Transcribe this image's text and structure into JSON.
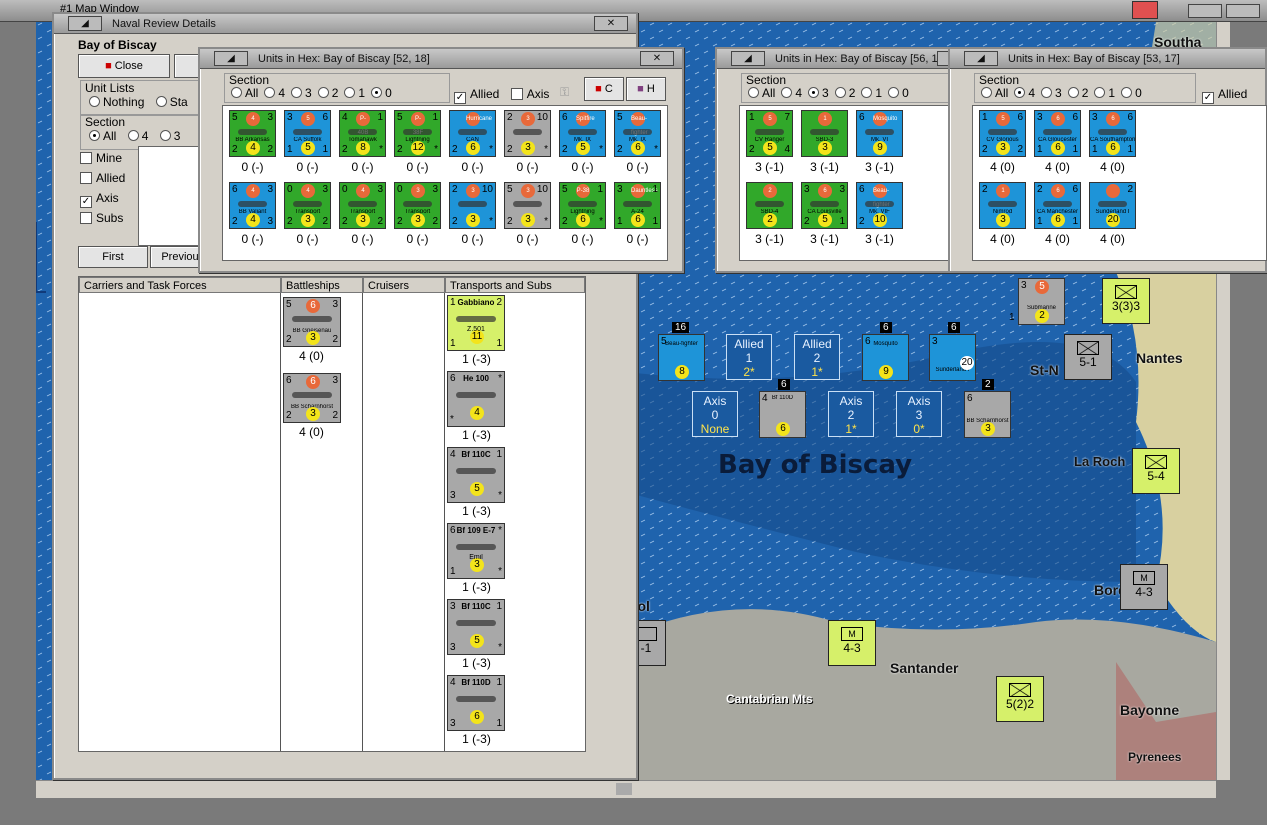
{
  "map_window": {
    "title": "#1 Map Window"
  },
  "naval_review": {
    "title": "Naval Review Details",
    "location": "Bay of Biscay",
    "close_label": "Close",
    "unit_lists_label": "Unit Lists",
    "unit_list_options": [
      "Nothing",
      "Sta"
    ],
    "section_label": "Section",
    "section_options": [
      "All",
      "4",
      "3"
    ],
    "filters": [
      {
        "label": "Mine",
        "checked": false
      },
      {
        "label": "Allied",
        "checked": false
      },
      {
        "label": "Axis",
        "checked": true
      },
      {
        "label": "Subs",
        "checked": false
      }
    ],
    "first_label": "First",
    "previous_label": "Previou",
    "columns": [
      "Carriers and Task Forces",
      "Battleships",
      "Cruisers",
      "Transports and Subs"
    ],
    "battleships": [
      {
        "name": "BB Gneisenau",
        "tl": "5",
        "tc": "6",
        "tr": "3",
        "bl": "2",
        "bc": "3",
        "br": "2",
        "str": "4 (0)"
      },
      {
        "name": "BB Scharnhorst",
        "tl": "6",
        "tc": "6",
        "tr": "3",
        "bl": "2",
        "bc": "3",
        "br": "2",
        "str": "4 (0)"
      }
    ],
    "transports": [
      {
        "name": "Z.501",
        "top": "Gabbiano",
        "tl": "1",
        "tr": "2",
        "bl": "1",
        "bc": "11",
        "br": "1",
        "str": "1 (-3)",
        "cls": "ltgreen"
      },
      {
        "name": "",
        "top": "He 100",
        "tl": "6",
        "tr": "*",
        "bl": "*",
        "bc": "4",
        "br": "",
        "str": "1 (-3)",
        "cls": "grey"
      },
      {
        "name": "",
        "top": "Bf 110C",
        "tl": "4",
        "tr": "1",
        "bl": "3",
        "bc": "5",
        "br": "*",
        "str": "1 (-3)",
        "cls": "grey"
      },
      {
        "name": "Emil",
        "top": "Bf 109 E-7",
        "tl": "6",
        "tr": "*",
        "bl": "1",
        "bc": "3",
        "br": "*",
        "str": "1 (-3)",
        "cls": "grey"
      },
      {
        "name": "",
        "top": "Bf 110C",
        "tl": "3",
        "tr": "1",
        "bl": "3",
        "bc": "5",
        "br": "*",
        "str": "1 (-3)",
        "cls": "grey"
      },
      {
        "name": "",
        "top": "Bf 110D",
        "tl": "4",
        "tr": "1",
        "bl": "3",
        "bc": "6",
        "br": "1",
        "str": "1 (-3)",
        "cls": "grey"
      }
    ]
  },
  "hex_windows": [
    {
      "title": "Units in Hex: Bay of Biscay [52, 18]",
      "section_label": "Section",
      "sections": [
        "All",
        "4",
        "3",
        "2",
        "1",
        "0"
      ],
      "selected": 5,
      "allied_label": "Allied",
      "axis_label": "Axis",
      "btn_c": "C",
      "btn_h": "H",
      "rows": [
        [
          {
            "name": "BB Arkansas",
            "tl": "5",
            "tc": "4",
            "tr": "3",
            "bl": "2",
            "bc": "4",
            "br": "2",
            "str": "0 (-)",
            "cls": "green"
          },
          {
            "name": "CA Suffolk",
            "tl": "3",
            "tc": "5",
            "tr": "6",
            "bl": "1",
            "bc": "5",
            "br": "1",
            "str": "0 (-)",
            "cls": "blue"
          },
          {
            "name": "Tomahawk",
            "tl": "4",
            "tc": "P-40B",
            "tr": "1",
            "bl": "2",
            "bc": "8",
            "br": "*",
            "str": "0 (-)",
            "cls": "green"
          },
          {
            "name": "Lightning",
            "tl": "5",
            "tc": "P-38F",
            "tr": "1",
            "bl": "2",
            "bc": "12",
            "br": "*",
            "str": "0 (-)",
            "cls": "green"
          },
          {
            "name": "CAN",
            "tl": "",
            "tc": "Hurricane",
            "tr": "",
            "bl": "2",
            "bc": "6",
            "br": "*",
            "str": "0 (-)",
            "cls": "blue"
          },
          {
            "name": "",
            "tl": "2",
            "tc": "3",
            "tr": "10",
            "bl": "2",
            "bc": "3",
            "br": "*",
            "str": "0 (-)",
            "cls": "grey"
          },
          {
            "name": "Mk. IX",
            "tl": "6",
            "tc": "Spitfire",
            "tr": "",
            "bl": "2",
            "bc": "5",
            "br": "*",
            "str": "0 (-)",
            "cls": "blue"
          },
          {
            "name": "Mk. IX",
            "tl": "5",
            "tc": "Beau-fighter",
            "tr": "",
            "bl": "2",
            "bc": "6",
            "br": "*",
            "str": "0 (-)",
            "cls": "blue"
          }
        ],
        [
          {
            "name": "BB Valiant",
            "tl": "6",
            "tc": "4",
            "tr": "3",
            "bl": "2",
            "bc": "4",
            "br": "3",
            "str": "0 (-)",
            "cls": "blue"
          },
          {
            "name": "Transport",
            "tl": "0",
            "tc": "4",
            "tr": "3",
            "bl": "2",
            "bc": "3",
            "br": "2",
            "str": "0 (-)",
            "cls": "green"
          },
          {
            "name": "Transport",
            "tl": "0",
            "tc": "4",
            "tr": "3",
            "bl": "2",
            "bc": "3",
            "br": "2",
            "str": "0 (-)",
            "cls": "green"
          },
          {
            "name": "Transport",
            "tl": "0",
            "tc": "3",
            "tr": "3",
            "bl": "2",
            "bc": "3",
            "br": "2",
            "str": "0 (-)",
            "cls": "green"
          },
          {
            "name": "",
            "tl": "2",
            "tc": "3",
            "tr": "10",
            "bl": "2",
            "bc": "3",
            "br": "*",
            "str": "0 (-)",
            "cls": "blue"
          },
          {
            "name": "",
            "tl": "5",
            "tc": "3",
            "tr": "10",
            "bl": "2",
            "bc": "3",
            "br": "*",
            "str": "0 (-)",
            "cls": "grey"
          },
          {
            "name": "Lightning",
            "tl": "5",
            "tc": "P-38",
            "tr": "1",
            "bl": "2",
            "bc": "6",
            "br": "*",
            "str": "0 (-)",
            "cls": "green"
          },
          {
            "name": "A-24",
            "tl": "3",
            "tc": "Dauntless",
            "tr": "1",
            "bl": "1",
            "bc": "6",
            "br": "1",
            "str": "0 (-)",
            "cls": "green"
          }
        ]
      ]
    },
    {
      "title": "Units in Hex: Bay of Biscay [56, 17]",
      "section_label": "Section",
      "sections": [
        "All",
        "4",
        "3",
        "2",
        "1",
        "0"
      ],
      "selected": 2,
      "rows": [
        [
          {
            "name": "CV Ranger",
            "tl": "1",
            "tc": "5",
            "tr": "7",
            "bl": "2",
            "bc": "5",
            "br": "4",
            "str": "3 (-1)",
            "cls": "green"
          },
          {
            "name": "SBD-3",
            "tl": "",
            "tc": "1",
            "tr": "",
            "bl": "",
            "bc": "3",
            "br": "",
            "str": "3 (-1)",
            "cls": "green"
          },
          {
            "name": "Mk. VI",
            "tl": "6",
            "tc": "Mosquito",
            "tr": "",
            "bl": "",
            "bc": "9",
            "br": "",
            "str": "3 (-1)",
            "cls": "blue"
          }
        ],
        [
          {
            "name": "SBD-4",
            "tl": "",
            "tc": "2",
            "tr": "",
            "bl": "",
            "bc": "2",
            "br": "",
            "str": "3 (-1)",
            "cls": "green"
          },
          {
            "name": "CA Louisville",
            "tl": "3",
            "tc": "6",
            "tr": "3",
            "bl": "2",
            "bc": "5",
            "br": "1",
            "str": "3 (-1)",
            "cls": "green"
          },
          {
            "name": "Mk. VIF",
            "tl": "6",
            "tc": "Beau-fighter",
            "tr": "",
            "bl": "2",
            "bc": "10",
            "br": "",
            "str": "3 (-1)",
            "cls": "blue"
          }
        ]
      ]
    },
    {
      "title": "Units in Hex: Bay of Biscay [53, 17]",
      "section_label": "Section",
      "sections": [
        "All",
        "4",
        "3",
        "2",
        "1",
        "0"
      ],
      "selected": 1,
      "allied_label": "Allied",
      "rows": [
        [
          {
            "name": "CV Glorious",
            "tl": "1",
            "tc": "5",
            "tr": "6",
            "bl": "2",
            "bc": "3",
            "br": "2",
            "str": "4 (0)",
            "cls": "blue"
          },
          {
            "name": "CA Gloucester",
            "tl": "3",
            "tc": "6",
            "tr": "6",
            "bl": "1",
            "bc": "6",
            "br": "1",
            "str": "4 (0)",
            "cls": "blue"
          },
          {
            "name": "CA Southampton",
            "tl": "3",
            "tc": "6",
            "tr": "6",
            "bl": "1",
            "bc": "6",
            "br": "1",
            "str": "4 (0)",
            "cls": "blue"
          }
        ],
        [
          {
            "name": "Nimrod",
            "tl": "2",
            "tc": "1",
            "tr": "",
            "bl": "",
            "bc": "3",
            "br": "",
            "str": "4 (0)",
            "cls": "blue"
          },
          {
            "name": "CA Manchester",
            "tl": "2",
            "tc": "6",
            "tr": "6",
            "bl": "1",
            "bc": "6",
            "br": "1",
            "str": "4 (0)",
            "cls": "blue"
          },
          {
            "name": "Sunderland I",
            "tl": "",
            "tc": "",
            "tr": "2",
            "bl": "",
            "bc": "20",
            "br": "",
            "str": "4 (0)",
            "cls": "blue"
          }
        ]
      ]
    }
  ],
  "map": {
    "sea_label": "Bay of Biscay",
    "labels": [
      "Nantes",
      "St-N",
      "La Roch",
      "Bord",
      "Santander",
      "Cantabrian Mts",
      "Bayonne",
      "Pyrenees",
      "rol",
      "Southa"
    ],
    "boxes": [
      {
        "side": "Allied",
        "num": "1",
        "val": "2*"
      },
      {
        "side": "Allied",
        "num": "2",
        "val": "1*"
      },
      {
        "side": "Axis",
        "num": "0",
        "val": "None"
      },
      {
        "side": "Axis",
        "num": "2",
        "val": "1*"
      },
      {
        "side": "Axis",
        "num": "3",
        "val": "0*"
      }
    ],
    "stack_counts": [
      "16",
      "6",
      "6",
      "6",
      "2"
    ],
    "sea_units": [
      {
        "tl": "5",
        "bc": "8",
        "name": "Beau-fighter"
      },
      {
        "tl": "6",
        "bc": "9",
        "name": "Mosquito"
      },
      {
        "tl": "3",
        "bc": "20",
        "name": "Sunderland I"
      },
      {
        "tl": "4",
        "bc": "6",
        "name": "Bf 110D"
      },
      {
        "tl": "6",
        "bc": "3",
        "name": "BB Scharnhorst"
      }
    ],
    "land_units": [
      {
        "strength": "5-1"
      },
      {
        "strength": "5-4"
      },
      {
        "strength": "4-3"
      },
      {
        "strength": "4-3"
      },
      {
        "strength": "5(2)2"
      },
      {
        "strength": "3(3)3"
      },
      {
        "strength": "-1"
      }
    ],
    "top_unit": {
      "tl": "3",
      "tc": "5",
      "name": "Submarine",
      "bc": "2",
      "sub": "1"
    }
  },
  "colors": {
    "sea": "#1d5fa8",
    "land": "#a8a8a0",
    "france": "#d8d0a0",
    "allied_green": "#31a82a",
    "allied_blue": "#1e94d8",
    "axis_grey": "#a8a8a8",
    "axis_green": "#d6f06a"
  }
}
